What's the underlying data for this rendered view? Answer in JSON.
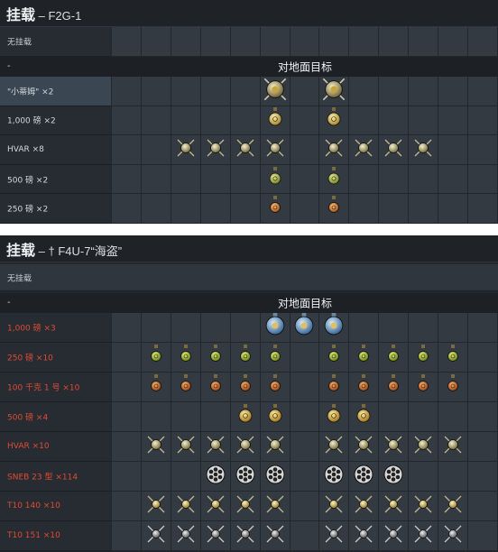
{
  "panel1": {
    "title": "挂载",
    "title_sep": " – ",
    "aircraft": "F2G-1",
    "no_loadout": "无挂载",
    "dash": "-",
    "group_header": "对地面目标",
    "rows": [
      {
        "label": "\"小蒂姆\" ×2",
        "cols": [
          5,
          7
        ],
        "icon": "tiny-tim-rocket-icon"
      },
      {
        "label": "1,000 磅 ×2",
        "cols": [
          5,
          7
        ],
        "icon": "bomb-1000lb-icon"
      },
      {
        "label": "HVAR ×8",
        "cols": [
          2,
          3,
          4,
          5,
          7,
          8,
          9,
          10
        ],
        "icon": "hvar-rocket-icon"
      },
      {
        "label": "500 磅 ×2",
        "cols": [
          5,
          7
        ],
        "icon": "bomb-500lb-icon"
      },
      {
        "label": "250 磅 ×2",
        "cols": [
          5,
          7
        ],
        "icon": "bomb-250lb-icon"
      }
    ]
  },
  "panel2": {
    "title": "挂载",
    "title_sep": " – ",
    "aircraft": "† F4U-7“海盗”",
    "no_loadout": "无挂载",
    "dash": "-",
    "group_header": "对地面目标",
    "rows": [
      {
        "label": "1,000 磅 ×3",
        "cols": [
          5,
          6,
          7
        ],
        "icon": "bomb-1000lb-blue-icon"
      },
      {
        "label": "250 磅 ×10",
        "cols": [
          1,
          2,
          3,
          4,
          5,
          7,
          8,
          9,
          10,
          11
        ],
        "icon": "bomb-250lb-green-icon"
      },
      {
        "label": "100 千克 1 号 ×10",
        "cols": [
          1,
          2,
          3,
          4,
          5,
          7,
          8,
          9,
          10,
          11
        ],
        "icon": "bomb-100kg-icon"
      },
      {
        "label": "500 磅 ×4",
        "cols": [
          4,
          5,
          7,
          8
        ],
        "icon": "bomb-500lb-gold-icon"
      },
      {
        "label": "HVAR ×10",
        "cols": [
          1,
          2,
          3,
          4,
          5,
          7,
          8,
          9,
          10,
          11
        ],
        "icon": "hvar-rocket-icon"
      },
      {
        "label": "SNEB 23 型 ×114",
        "cols": [
          3,
          4,
          5,
          7,
          8,
          9
        ],
        "icon": "rocket-pod-icon"
      },
      {
        "label": "T10 140 ×10",
        "cols": [
          1,
          2,
          3,
          4,
          5,
          7,
          8,
          9,
          10,
          11
        ],
        "icon": "t10-140-rocket-icon"
      },
      {
        "label": "T10 151 ×10",
        "cols": [
          1,
          2,
          3,
          4,
          5,
          7,
          8,
          9,
          10,
          11
        ],
        "icon": "t10-151-rocket-icon"
      }
    ]
  },
  "colors": {
    "panel_bg": "#23282e",
    "cell_bg": "#333a41",
    "label_red": "#e04a35",
    "label_white": "#d2d8dc",
    "highlight_row": "#3a4652"
  }
}
